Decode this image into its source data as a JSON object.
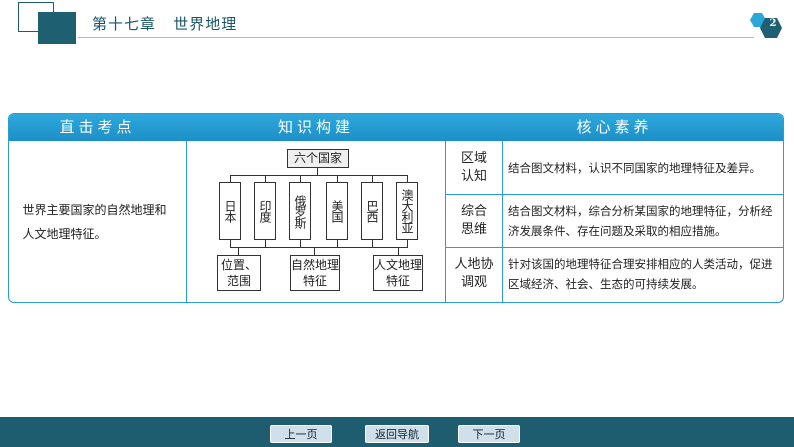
{
  "header": {
    "chapter_title": "第十七章   世界地理",
    "page_number": "2",
    "accent_color": "#1f5f72"
  },
  "table": {
    "headers": [
      "直击考点",
      "知识构建",
      "核心素养"
    ],
    "exam_point": "世界主要国家的自然地理和人文地理特征。",
    "diagram": {
      "root": "六个国家",
      "countries": [
        "日本",
        "印度",
        "俄罗斯",
        "美国",
        "巴西",
        "澳大利亚"
      ],
      "aspects": [
        "位置、范围",
        "自然地理特征",
        "人文地理特征"
      ]
    },
    "competencies": [
      {
        "label": "区域认知",
        "text": "结合图文材料，认识不同国家的地理特征及差异。"
      },
      {
        "label": "综合思维",
        "text": "结合图文材料，综合分析某国家的地理特征，分析经济发展条件、存在问题及采取的相应措施。"
      },
      {
        "label": "人地协调观",
        "text": "针对该国的地理特征合理安排相应的人类活动，促进区域经济、社会、生态的可持续发展。"
      }
    ]
  },
  "footer": {
    "prev": "上一页",
    "nav": "返回导航",
    "next": "下一页"
  }
}
